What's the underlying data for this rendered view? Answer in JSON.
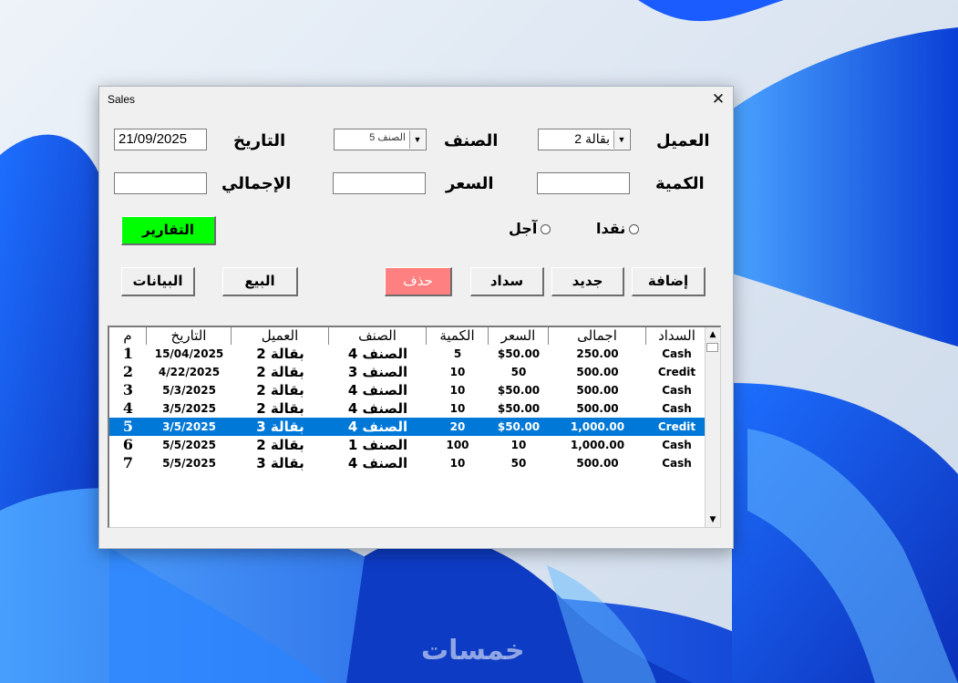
{
  "window": {
    "title": "Sales",
    "close_glyph": "✕"
  },
  "form": {
    "customer_label": "العميل",
    "customer_value": "بقالة 2",
    "item_label": "الصنف",
    "item_value": "الصنف 5",
    "date_label": "التاريخ",
    "date_value": "21/09/2025",
    "qty_label": "الكمية",
    "qty_value": "",
    "price_label": "السعر",
    "price_value": "",
    "total_label": "الإجمالي",
    "total_value": "",
    "radio_cash": "نقدا",
    "radio_credit": "آجل"
  },
  "buttons": {
    "reports": "التقارير",
    "add": "إضافة",
    "new": "جديد",
    "pay": "سداد",
    "delete": "حذف",
    "sell": "البيع",
    "data": "البيانات"
  },
  "table": {
    "headers": [
      "م",
      "التاريخ",
      "العميل",
      "الصنف",
      "الكمية",
      "السعر",
      "اجمالى",
      "السداد"
    ],
    "rows": [
      [
        "1",
        "15/04/2025",
        "بقالة 2",
        "الصنف 4",
        "5",
        "$50.00",
        "250.00",
        "Cash"
      ],
      [
        "2",
        "4/22/2025",
        "بقالة 2",
        "الصنف 3",
        "10",
        "50",
        "500.00",
        "Credit"
      ],
      [
        "3",
        "5/3/2025",
        "بقالة 2",
        "الصنف 4",
        "10",
        "$50.00",
        "500.00",
        "Cash"
      ],
      [
        "4",
        "3/5/2025",
        "بقالة 2",
        "الصنف 4",
        "10",
        "$50.00",
        "500.00",
        "Cash"
      ],
      [
        "5",
        "3/5/2025",
        "بقالة 3",
        "الصنف 4",
        "20",
        "$50.00",
        "1,000.00",
        "Credit"
      ],
      [
        "6",
        "5/5/2025",
        "بقالة 2",
        "الصنف 1",
        "100",
        "10",
        "1,000.00",
        "Cash"
      ],
      [
        "7",
        "5/5/2025",
        "بقالة 3",
        "الصنف 4",
        "10",
        "50",
        "500.00",
        "Cash"
      ]
    ],
    "selected_row": 5
  },
  "watermark": "خمسات",
  "colors": {
    "reports_button": "#00ff00",
    "delete_button": "#ff8080",
    "selection": "#0078d7"
  }
}
